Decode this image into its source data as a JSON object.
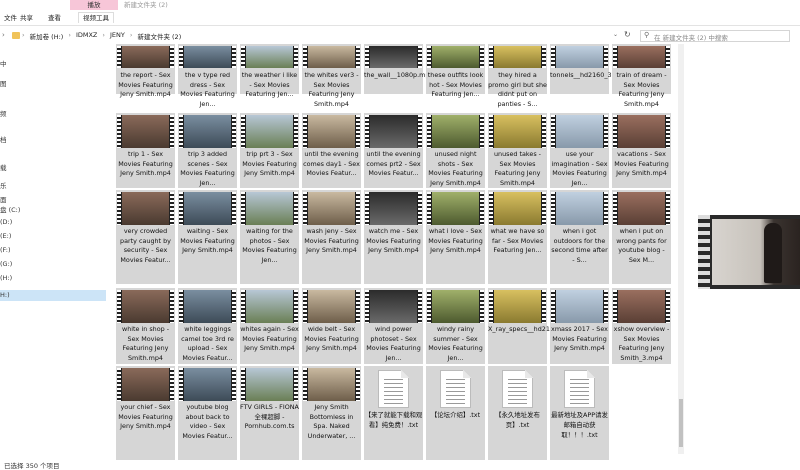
{
  "window": {
    "title": "新建文件夹 (2)",
    "context_tab": "播放",
    "ribbon_tabs": [
      "文件",
      "共享",
      "查看",
      "视频工具"
    ]
  },
  "address": {
    "crumbs": [
      "新加卷 (H:)",
      "IDMXZ",
      "JENY",
      "新建文件夹 (2)"
    ],
    "search_placeholder": "在 新建文件夹 (2) 中搜索"
  },
  "sidebar": {
    "fragments": [
      "中",
      "图",
      "频",
      "档",
      "载",
      "乐",
      "面"
    ],
    "items": [
      "盘 (C:)",
      "(D:)",
      "(E:)",
      "(F:)",
      "(G:)",
      "(H:)",
      "H:)"
    ],
    "selected_index": 6
  },
  "files": [
    [
      "the report - Sex Movies Featuring Jeny Smith.mp4",
      "the v type red dress - Sex Movies Featuring Jen...",
      "the weather i like - Sex Movies Featuring Jen...",
      "the whites ver3 - Sex Movies Featuring Jeny Smith.mp4",
      "the_wall__1080p.mp4",
      "these outfits look hot - Sex Movies Featuring Jen...",
      "they hired a promo girl but she didnt put on panties - S...",
      "tonnels__hd2160_3.mp4",
      "train of dream - Sex Movies Featuring Jeny Smith.mp4"
    ],
    [
      "trip 1 - Sex Movies Featuring Jeny Smith.mp4",
      "trip 3 added scenes - Sex Movies Featuring Jen...",
      "trip prt 3 - Sex Movies Featuring Jeny Smith.mp4",
      "until the evening comes day1 - Sex Movies Featur...",
      "until the evening comes prt2 - Sex Movies Featur...",
      "unused night shots - Sex Movies Featuring Jeny Smith.mp4",
      "unused takes - Sex Movies Featuring Jeny Smith.mp4",
      "use your imagination - Sex Movies Featuring Jen...",
      "vacations - Sex Movies Featuring Jeny Smith.mp4"
    ],
    [
      "very crowded party caught by security - Sex Movies Featur...",
      "waiting - Sex Movies Featuring Jeny Smith.mp4",
      "waiting for the photos - Sex Movies Featuring Jen...",
      "wash jeny - Sex Movies Featuring Jeny Smith.mp4",
      "watch me - Sex Movies Featuring Jeny Smith.mp4",
      "what i love - Sex Movies Featuring Jeny Smith.mp4",
      "what we have so far - Sex Movies Featuring Jen...",
      "when i got outdoors for the second time after - S...",
      "when i put on wrong pants for youtube blog - Sex M..."
    ],
    [
      "white in shop - Sex Movies Featuring Jeny Smith.mp4",
      "white leggings camel toe 3rd re upload - Sex Movies Featur...",
      "whites again - Sex Movies Featuring Jeny Smith.mp4",
      "wide belt - Sex Movies Featuring Jeny Smith.mp4",
      "wind power photoset - Sex Movies Featuring Jen...",
      "windy rainy summer - Sex Movies Featuring Jen...",
      "X_ray_specs__hd2160.mp4",
      "xmass 2017 - Sex Movies Featuring Jeny Smith.mp4",
      "xshow overview - Sex Movies Featuring Jeny Smith_3.mp4"
    ],
    [
      "your chief - Sex Movies Featuring Jeny Smith.mp4",
      "youtube blog about back to video - Sex Movies Featur...",
      "FTV GIRLS - FIONA 全裸超脚 - Pornhub.com.ts",
      "Jeny Smith Bottomless in Spa. Naked Underwater, ...",
      "【来了就能下载和观看】纯免费！.txt",
      "【论坛介绍】.txt",
      "【永久地址发布页】.txt",
      "最新地址及APP请发邮箱自动获取！！！.txt"
    ]
  ],
  "status": "已选择 350 个项目"
}
